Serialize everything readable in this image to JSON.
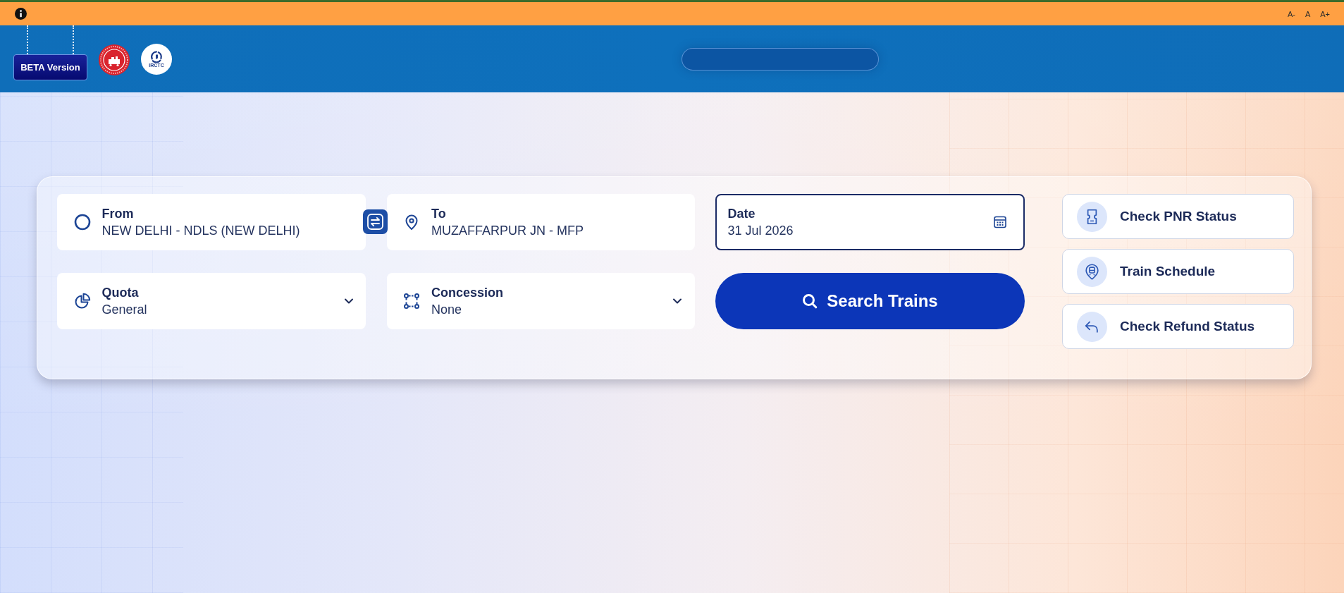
{
  "top_bar": {
    "text_size_buttons": [
      "A-",
      "A",
      "A+"
    ]
  },
  "header": {
    "badge": "BETA Version",
    "logo_text": "IRCTC"
  },
  "search_form": {
    "fields": [
      {
        "kind": "origin",
        "label": "From",
        "value": "NEW DELHI - NDLS (NEW DELHI)",
        "focused": false
      },
      {
        "kind": "destination",
        "label": "To",
        "value": "MUZAFFARPUR JN - MFP",
        "focused": false
      },
      {
        "kind": "date",
        "label": "Date",
        "value": "31 Jul 2026",
        "focused": true
      },
      {
        "kind": "quota",
        "label": "Quota",
        "value": "General",
        "focused": false
      },
      {
        "kind": "concession",
        "label": "Concession",
        "value": "None",
        "focused": false
      }
    ],
    "search_button": "Search Trains"
  },
  "quick_links": [
    {
      "kind": "pnr",
      "label": "Check PNR Status"
    },
    {
      "kind": "schedule",
      "label": "Train Schedule"
    },
    {
      "kind": "refund",
      "label": "Check Refund Status"
    }
  ]
}
